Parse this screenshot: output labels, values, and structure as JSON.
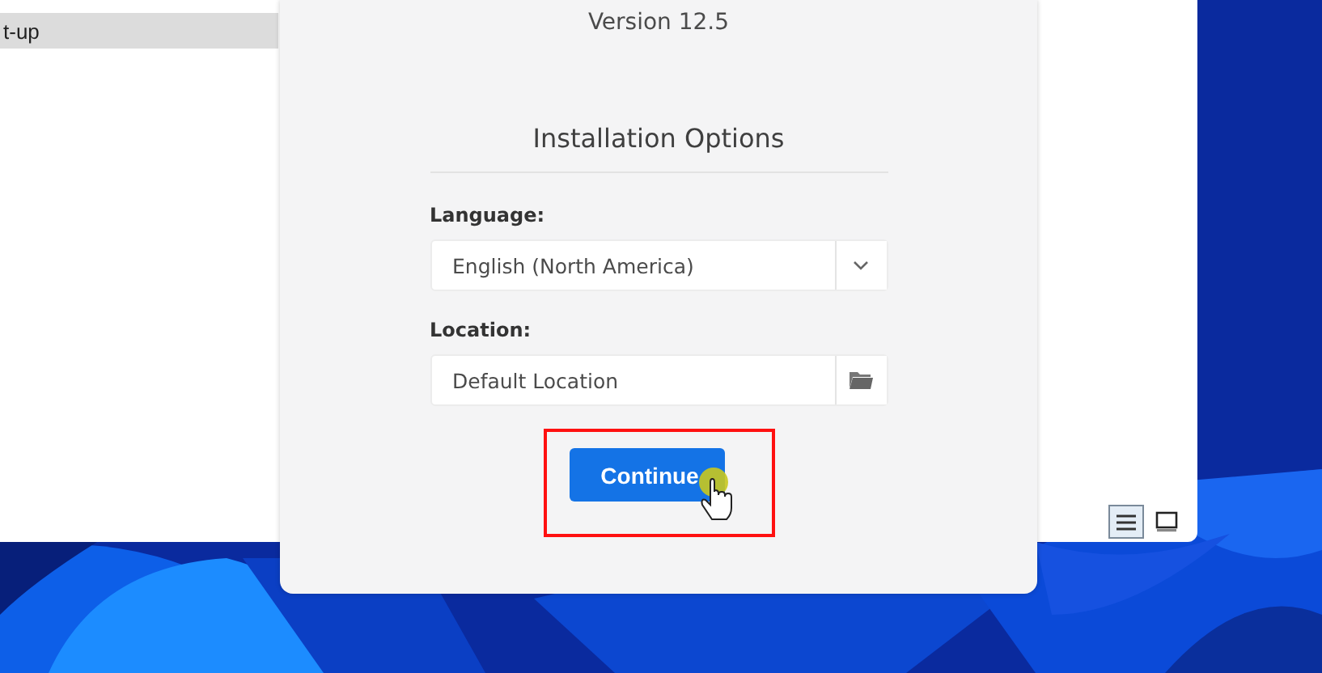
{
  "background_window": {
    "list_items": [
      {
        "label": "t-up",
        "selected": true
      }
    ],
    "view_buttons": [
      {
        "kind": "list",
        "selected": true
      },
      {
        "kind": "tiles",
        "selected": false
      }
    ]
  },
  "dialog": {
    "version": "Version 12.5",
    "heading": "Installation Options",
    "fields": [
      {
        "kind": "dropdown",
        "label": "Language:",
        "value": "English (North America)"
      },
      {
        "kind": "folder",
        "label": "Location:",
        "value": "Default Location"
      }
    ],
    "primary_button": {
      "label": "Continue",
      "highlighted": true
    }
  }
}
